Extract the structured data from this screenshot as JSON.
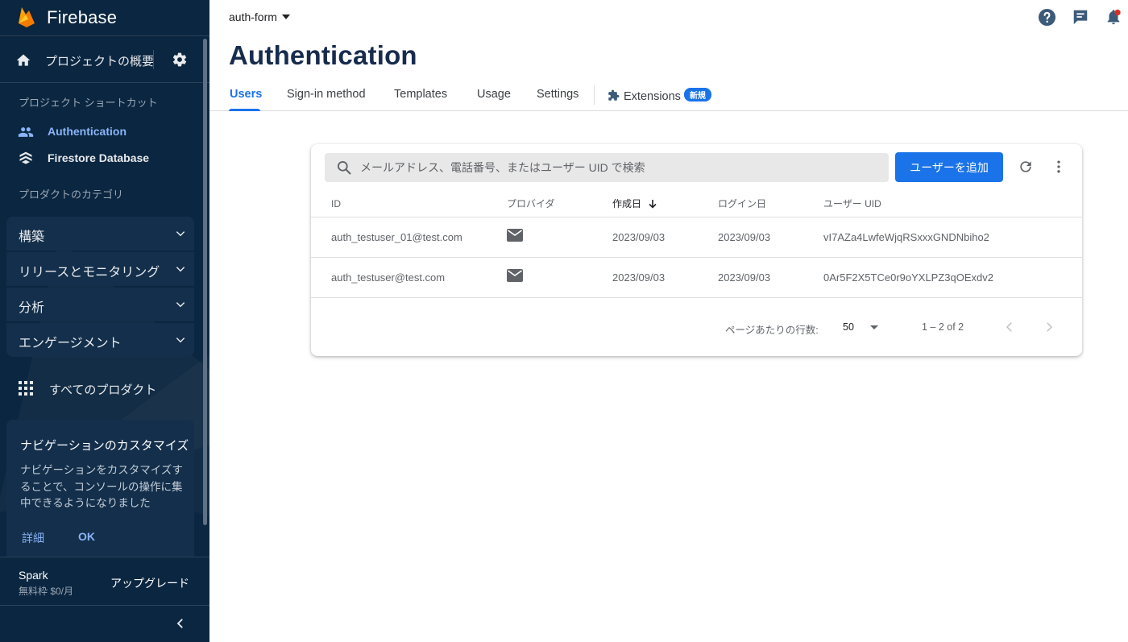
{
  "sidebar": {
    "brand": "Firebase",
    "overview_label": "プロジェクトの概要",
    "shortcuts_title": "プロジェクト ショートカット",
    "shortcuts": [
      {
        "label": "Authentication",
        "icon": "people-icon",
        "active": true
      },
      {
        "label": "Firestore Database",
        "icon": "firestore-icon",
        "active": false
      }
    ],
    "categories_title": "プロダクトのカテゴリ",
    "categories": [
      {
        "label": "構築"
      },
      {
        "label": "リリースとモニタリング"
      },
      {
        "label": "分析"
      },
      {
        "label": "エンゲージメント"
      }
    ],
    "all_products": "すべてのプロダクト",
    "customize": {
      "title": "ナビゲーションのカスタマイズ",
      "body": "ナビゲーションをカスタマイズすることで、コンソールの操作に集中できるようになりました",
      "details_link": "詳細",
      "ok_link": "OK"
    },
    "plan": {
      "name": "Spark",
      "subtitle": "無料枠 $0/月",
      "upgrade": "アップグレード"
    }
  },
  "header": {
    "project": "auth-form",
    "title": "Authentication",
    "icons": [
      "help-icon",
      "feedback-icon",
      "notifications-icon"
    ]
  },
  "tabs": [
    {
      "label": "Users",
      "active": true
    },
    {
      "label": "Sign-in method",
      "active": false
    },
    {
      "label": "Templates",
      "active": false
    },
    {
      "label": "Usage",
      "active": false
    },
    {
      "label": "Settings",
      "active": false
    },
    {
      "label": "Extensions",
      "badge": "新規",
      "active": false
    }
  ],
  "users": {
    "search_placeholder": "メールアドレス、電話番号、またはユーザー UID で検索",
    "add_button": "ユーザーを追加",
    "columns": [
      "ID",
      "プロバイダ",
      "作成日",
      "ログイン日",
      "ユーザー UID"
    ],
    "sort_column": "作成日",
    "rows": [
      {
        "id": "auth_testuser_01@test.com",
        "provider": "mail-icon",
        "created": "2023/09/03",
        "signed_in": "2023/09/03",
        "uid": "vI7AZa4LwfeWjqRSxxxGNDNbiho2"
      },
      {
        "id": "auth_testuser@test.com",
        "provider": "mail-icon",
        "created": "2023/09/03",
        "signed_in": "2023/09/03",
        "uid": "0Ar5F2X5TCe0r9oYXLPZ3qOExdv2"
      }
    ],
    "pagination": {
      "rows_per_page_label": "ページあたりの行数:",
      "rows_per_page": "50",
      "range": "1 – 2 of 2"
    }
  },
  "colors": {
    "sidebar_bg": "#0b2640",
    "accent": "#1a73e8",
    "active_nav": "#8ab4f8"
  }
}
